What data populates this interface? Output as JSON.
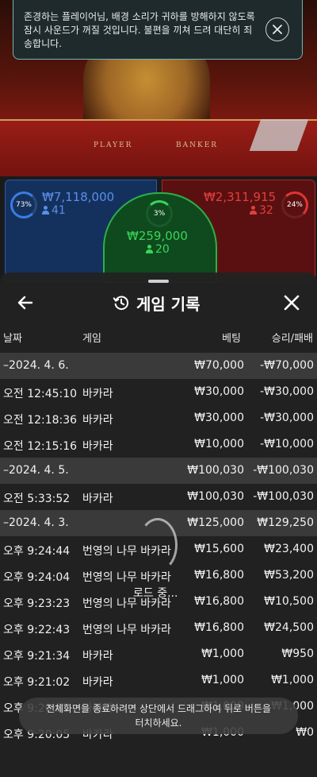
{
  "notice": {
    "message": "존경하는 플레이어님, 배경 소리가 귀하를 방해하지 않도록 잠시 사운드가 꺼질 것입니다. 불편을 끼쳐 드려 대단히 죄송합니다."
  },
  "video": {
    "player_label": "PLAYER",
    "banker_label": "BANKER"
  },
  "bets": {
    "player": {
      "percent": "73%",
      "amount": "₩7,118,000",
      "count": "41",
      "color": "#3d7be0"
    },
    "tie": {
      "percent": "3%",
      "amount": "₩259,000",
      "count": "20",
      "color": "#3ad45a"
    },
    "banker": {
      "percent": "24%",
      "amount": "₩2,311,915",
      "count": "32",
      "color": "#e03434"
    }
  },
  "history": {
    "title": "게임 기록",
    "columns": {
      "date": "날짜",
      "game": "게임",
      "bet": "베팅",
      "result": "승리/패배"
    },
    "rows": [
      {
        "type": "day",
        "date": "–2024. 4. 6.",
        "game": "",
        "bet": "₩70,000",
        "result": "-₩70,000"
      },
      {
        "type": "item",
        "date": "오전 12:45:10",
        "game": "바카라",
        "bet": "₩30,000",
        "result": "-₩30,000"
      },
      {
        "type": "item",
        "date": "오전 12:18:36",
        "game": "바카라",
        "bet": "₩30,000",
        "result": "-₩30,000"
      },
      {
        "type": "item",
        "date": "오전 12:15:16",
        "game": "바카라",
        "bet": "₩10,000",
        "result": "-₩10,000"
      },
      {
        "type": "day",
        "date": "–2024. 4. 5.",
        "game": "",
        "bet": "₩100,030",
        "result": "-₩100,030"
      },
      {
        "type": "item",
        "date": "오전 5:33:52",
        "game": "바카라",
        "bet": "₩100,030",
        "result": "-₩100,030"
      },
      {
        "type": "day",
        "date": "–2024. 4. 3.",
        "game": "",
        "bet": "₩125,000",
        "result": "₩129,250"
      },
      {
        "type": "item",
        "date": "오후 9:24:44",
        "game": "번영의 나무 바카라",
        "bet": "₩15,600",
        "result": "₩23,400"
      },
      {
        "type": "item",
        "date": "오후 9:24:04",
        "game": "번영의 나무 바카라",
        "bet": "₩16,800",
        "result": "₩53,200"
      },
      {
        "type": "item",
        "date": "오후 9:23:23",
        "game": "번영의 나무 바카라",
        "bet": "₩16,800",
        "result": "₩10,500"
      },
      {
        "type": "item",
        "date": "오후 9:22:43",
        "game": "번영의 나무 바카라",
        "bet": "₩16,800",
        "result": "₩24,500"
      },
      {
        "type": "item",
        "date": "오후 9:21:34",
        "game": "바카라",
        "bet": "₩1,000",
        "result": "₩950"
      },
      {
        "type": "item",
        "date": "오후 9:21:02",
        "game": "바카라",
        "bet": "₩1,000",
        "result": "₩1,000"
      },
      {
        "type": "item",
        "date": "오후 9:20:35",
        "game": "바카라",
        "bet": "₩1,000",
        "result": "₩1,000"
      },
      {
        "type": "item",
        "date": "오후 9:20:05",
        "game": "바카라",
        "bet": "₩1,000",
        "result": "₩0"
      }
    ]
  },
  "loading": {
    "text": "로드 중..."
  },
  "hint": {
    "text": "전체화면을 종료하려면 상단에서 드래그하여 뒤로 버튼을 터치하세요."
  }
}
